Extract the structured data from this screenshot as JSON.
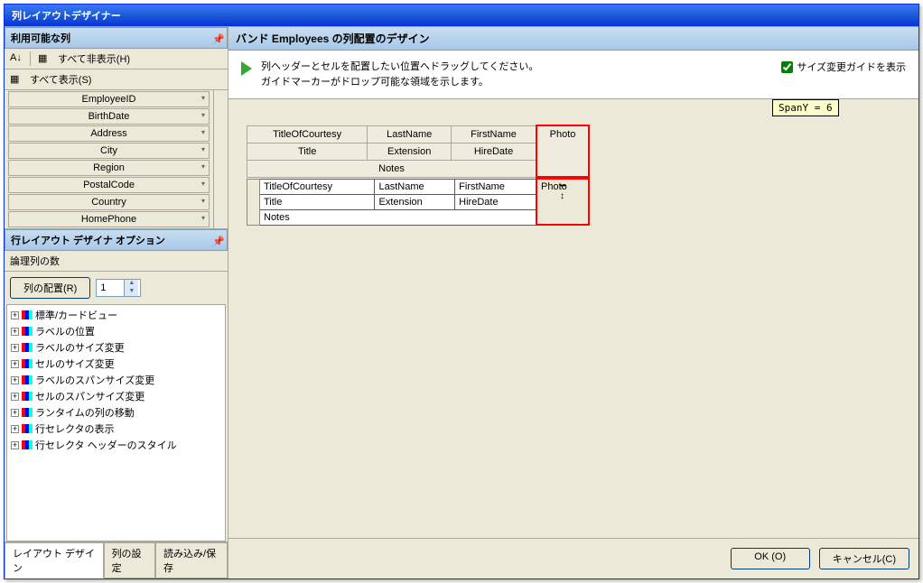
{
  "window": {
    "title": "列レイアウトデザイナー"
  },
  "leftPanel": {
    "header": "利用可能な列",
    "hideAll": "すべて非表示(H)",
    "showAll": "すべて表示(S)",
    "columns": [
      "EmployeeID",
      "BirthDate",
      "Address",
      "City",
      "Region",
      "PostalCode",
      "Country",
      "HomePhone"
    ]
  },
  "optionsPanel": {
    "header": "行レイアウト デザイナ オプション",
    "logicalColsLabel": "論理列の数",
    "arrangeButton": "列の配置(R)",
    "spinnerValue": "1",
    "treeItems": [
      "標準/カードビュー",
      "ラベルの位置",
      "ラベルのサイズ変更",
      "セルのサイズ変更",
      "ラベルのスパンサイズ変更",
      "セルのスパンサイズ変更",
      "ランタイムの列の移動",
      "行セレクタの表示",
      "行セレクタ ヘッダーのスタイル"
    ]
  },
  "tabs": {
    "layout": "レイアウト デザイン",
    "columns": "列の設定",
    "io": "読み込み/保存"
  },
  "rightPanel": {
    "header": "バンド Employees の列配置のデザイン",
    "hint1": "列ヘッダーとセルを配置したい位置へドラッグしてください。",
    "hint2": "ガイドマーカーがドロップ可能な領域を示します。",
    "checkbox": "サイズ変更ガイドを表示",
    "spanTip": "SpanY = 6",
    "headerTable": {
      "r1": [
        "TitleOfCourtesy",
        "LastName",
        "FirstName",
        "Photo"
      ],
      "r2": [
        "Title",
        "Extension",
        "HireDate"
      ],
      "r3": "Notes"
    },
    "dataTable": {
      "r1": [
        "TitleOfCourtesy",
        "LastName",
        "FirstName",
        "Photo"
      ],
      "r2": [
        "Title",
        "Extension",
        "HireDate"
      ],
      "r3": "Notes"
    }
  },
  "footer": {
    "ok": "OK (O)",
    "cancel": "キャンセル(C)"
  }
}
